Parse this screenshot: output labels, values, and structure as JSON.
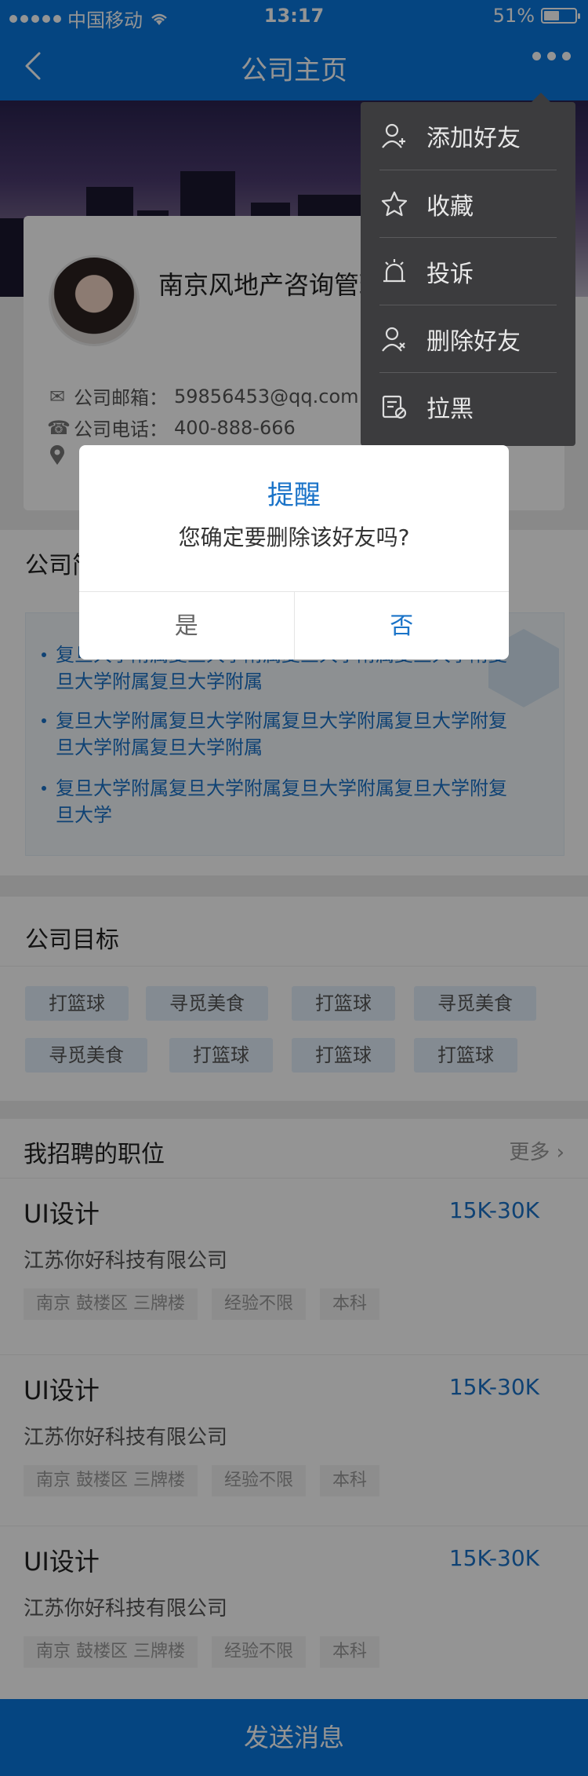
{
  "status_bar": {
    "carrier": "中国移动",
    "time": "13:17",
    "battery_text": "51%",
    "battery_level": 0.51
  },
  "nav": {
    "title": "公司主页"
  },
  "company": {
    "name": "南京风地产咨询管理有限公司",
    "email_label": "公司邮箱：",
    "email": "59856453@qq.com",
    "phone_label": "公司电话：",
    "phone": "400-888-666"
  },
  "intro": {
    "title": "公司简介",
    "items": [
      "复旦大学附属复旦大学附属复旦大学附属复旦大学附复旦大学附属复旦大学附属",
      "复旦大学附属复旦大学附属复旦大学附属复旦大学附复旦大学附属复旦大学附属",
      "复旦大学附属复旦大学附属复旦大学附属复旦大学附复旦大学"
    ]
  },
  "goals": {
    "title": "公司目标",
    "tags": [
      "打篮球",
      "寻觅美食",
      "打篮球",
      "寻觅美食",
      "寻觅美食",
      "打篮球",
      "打篮球",
      "打篮球"
    ]
  },
  "jobs": {
    "title": "我招聘的职位",
    "more": "更多",
    "items": [
      {
        "title": "UI设计",
        "salary": "15K-30K",
        "company": "江苏你好科技有限公司",
        "location": "南京 鼓楼区 三牌楼",
        "experience": "经验不限",
        "education": "本科"
      },
      {
        "title": "UI设计",
        "salary": "15K-30K",
        "company": "江苏你好科技有限公司",
        "location": "南京 鼓楼区 三牌楼",
        "experience": "经验不限",
        "education": "本科"
      },
      {
        "title": "UI设计",
        "salary": "15K-30K",
        "company": "江苏你好科技有限公司",
        "location": "南京 鼓楼区 三牌楼",
        "experience": "经验不限",
        "education": "本科"
      }
    ]
  },
  "send_button": "发送消息",
  "menu": {
    "items": [
      {
        "label": "添加好友",
        "icon": "add-user-icon"
      },
      {
        "label": "收藏",
        "icon": "star-icon"
      },
      {
        "label": "投诉",
        "icon": "alarm-icon"
      },
      {
        "label": "删除好友",
        "icon": "remove-user-icon"
      },
      {
        "label": "拉黑",
        "icon": "block-icon"
      }
    ]
  },
  "dialog": {
    "title": "提醒",
    "message": "您确定要删除该好友吗?",
    "yes": "是",
    "no": "否"
  },
  "colors": {
    "primary": "#0a78de",
    "accent": "#1a73c8",
    "menu_bg": "#3c3c3e"
  }
}
